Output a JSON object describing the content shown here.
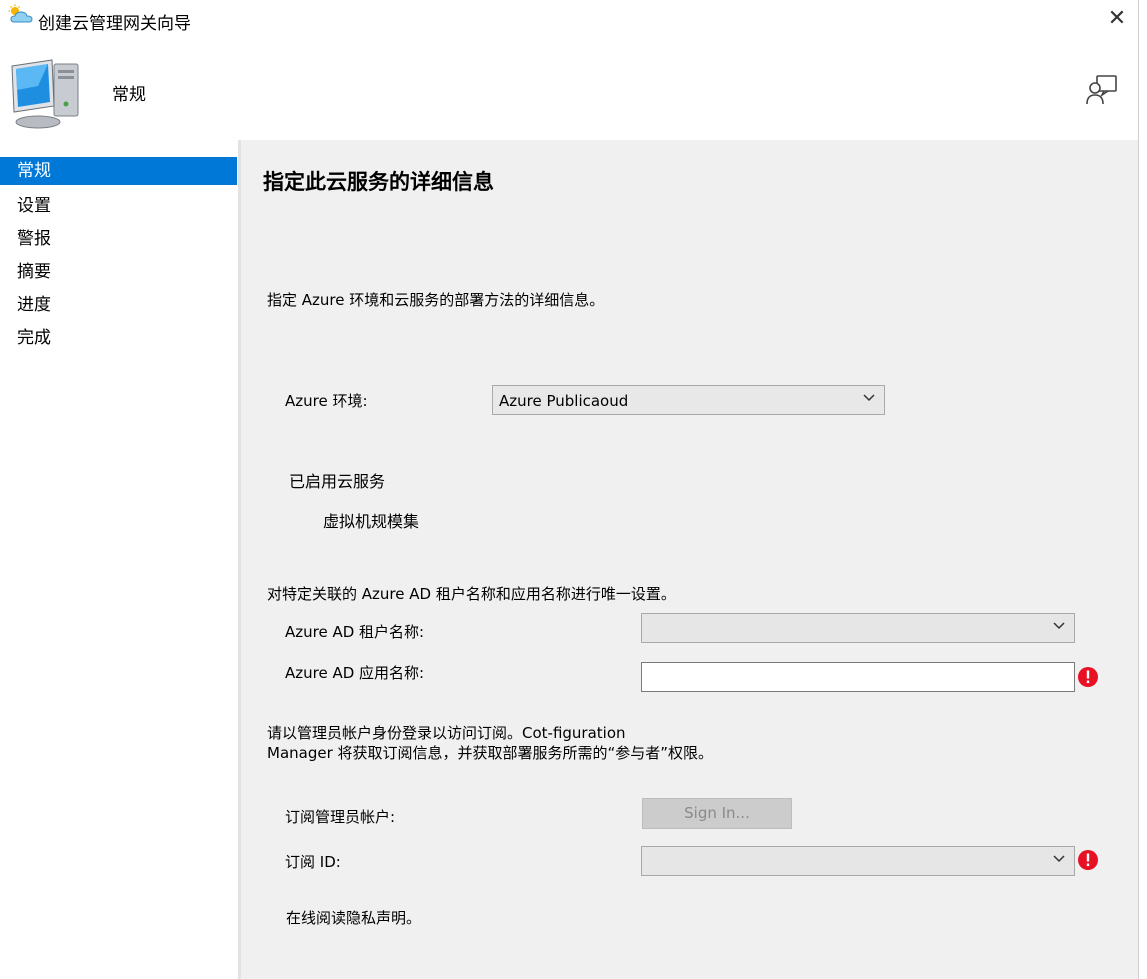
{
  "window": {
    "title": "创建云管理网关向导",
    "close_glyph": "✕"
  },
  "header": {
    "title": "常规"
  },
  "sidebar": {
    "items": [
      {
        "label": "常规",
        "active": true
      },
      {
        "label": "设置",
        "active": false
      },
      {
        "label": "警报",
        "active": false
      },
      {
        "label": "摘要",
        "active": false
      },
      {
        "label": "进度",
        "active": false
      },
      {
        "label": "完成",
        "active": false
      }
    ]
  },
  "main": {
    "heading": "指定此云服务的详细信息",
    "intro": "指定 Azure 环境和云服务的部署方法的详细信息。",
    "azure_env": {
      "label": "Azure 环境:",
      "value": "Azure Publicaoud"
    },
    "enabled_services_label": "已启用云服务",
    "vm_scale_set_label": "虚拟机规模集",
    "unique_setting_text": "对特定关联的 Azure AD 租户名称和应用名称进行唯一设置。",
    "tenant": {
      "label": "Azure AD 租户名称:",
      "value": ""
    },
    "app": {
      "label": "Azure AD 应用名称:",
      "value": ""
    },
    "signin_text_line1": "请以管理员帐户身份登录以访问订阅。Cot-figuration",
    "signin_text_line2": "Manager 将获取订阅信息，并获取部署服务所需的“参与者”权限。",
    "sub_admin": {
      "label": "订阅管理员帐户:",
      "button_label": "Sign In..."
    },
    "sub_id": {
      "label": "订阅 ID:",
      "value": ""
    },
    "privacy_link": "在线阅读隐私声明。"
  },
  "colors": {
    "accent": "#0078d7",
    "error": "#e81123",
    "panel_bg": "#f0f0f0"
  },
  "icons": [
    "cloud-app-icon",
    "close-icon",
    "computer-icon",
    "help-icon",
    "chevron-down-icon",
    "error-icon"
  ]
}
